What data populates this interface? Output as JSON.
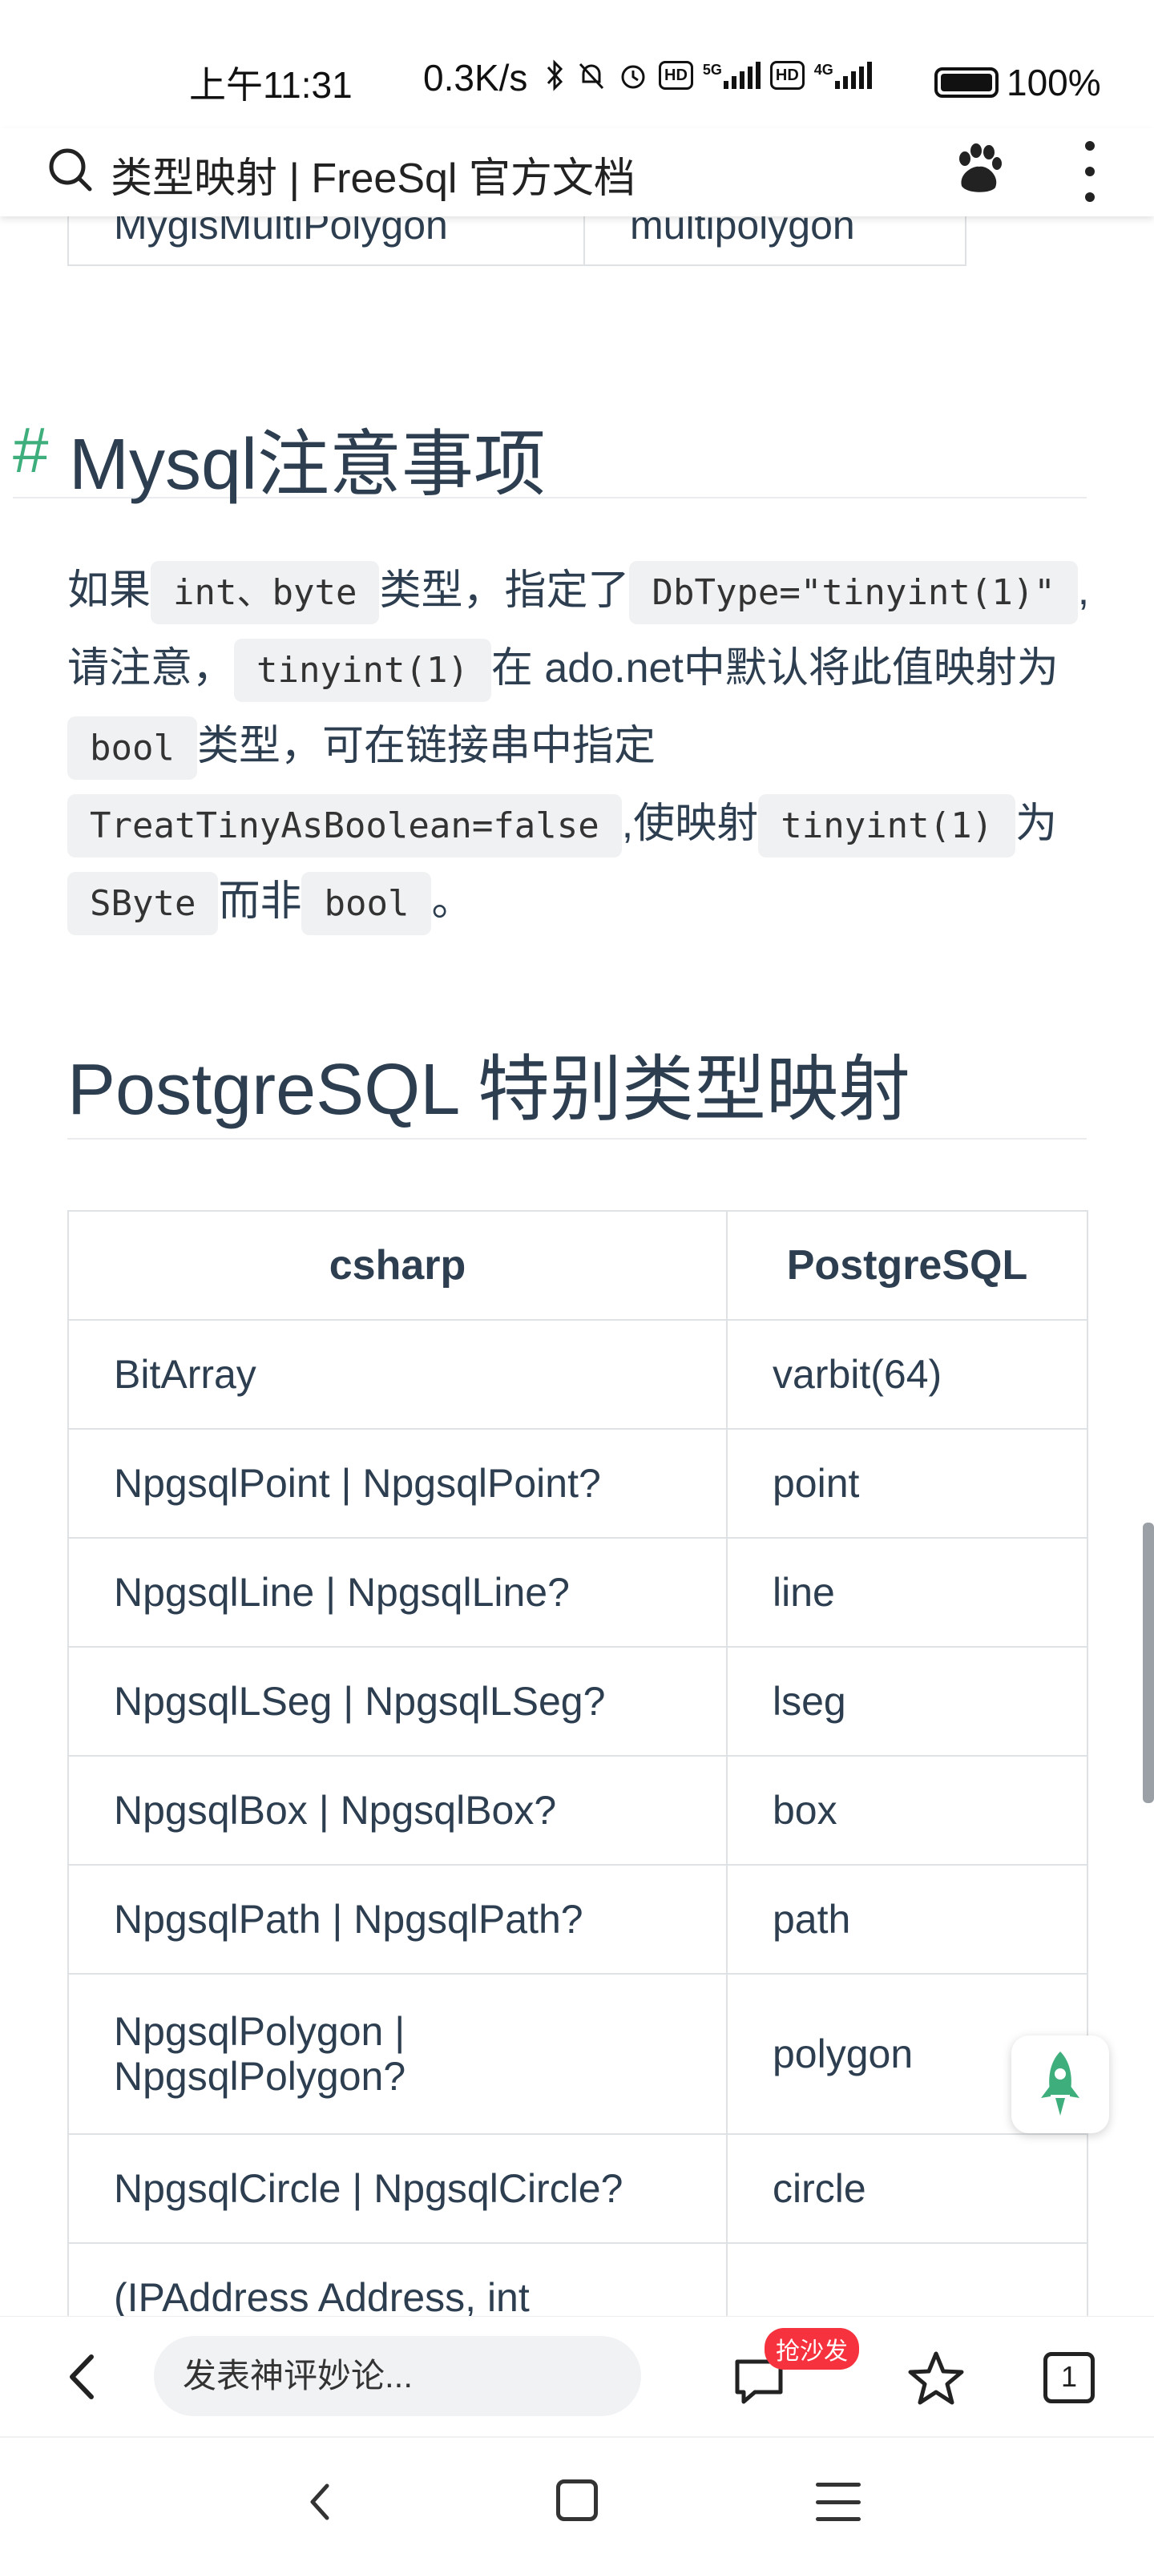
{
  "status": {
    "time": "上午11:31",
    "speed": "0.3K/s",
    "net1": "5G",
    "net2": "4G",
    "hd": "HD",
    "battery": "100%"
  },
  "address": {
    "title": "类型映射 | FreeSql 官方文档"
  },
  "top_table": {
    "row": [
      "MygisMultiPolygon",
      "multipolygon"
    ]
  },
  "mysql_section": {
    "anchor": "#",
    "heading": "Mysql注意事项",
    "p": {
      "t1": "如果",
      "c1": "int、byte",
      "t2": "类型，指定了",
      "c2": "DbType=\"tinyint(1)\"",
      "t3": ",请注意，",
      "c3": "tinyint(1)",
      "t4": "在 ado.net中默认将此值映射为",
      "c4": "bool",
      "t5": "类型，可在链接串中指定",
      "c5": "TreatTinyAsBoolean=false",
      "t6": ",使映射",
      "c6": "tinyint(1)",
      "t7": "为",
      "c7": "SByte",
      "t8": "而非",
      "c8": "bool",
      "t9": "。"
    }
  },
  "pg_section": {
    "heading": "PostgreSQL 特别类型映射",
    "headers": [
      "csharp",
      "PostgreSQL"
    ],
    "rows": [
      [
        "BitArray",
        "varbit(64)"
      ],
      [
        "NpgsqlPoint | NpgsqlPoint?",
        "point"
      ],
      [
        "NpgsqlLine | NpgsqlLine?",
        "line"
      ],
      [
        "NpgsqlLSeg | NpgsqlLSeg?",
        "lseg"
      ],
      [
        "NpgsqlBox | NpgsqlBox?",
        "box"
      ],
      [
        "NpgsqlPath | NpgsqlPath?",
        "path"
      ],
      [
        "NpgsqlPolygon | NpgsqlPolygon?",
        "polygon"
      ],
      [
        "NpgsqlCircle | NpgsqlCircle?",
        "circle"
      ],
      [
        "(IPAddress Address, int",
        ""
      ]
    ]
  },
  "bottom": {
    "comment_placeholder": "发表神评妙论...",
    "badge": "抢沙发",
    "tabs_count": "1"
  },
  "colors": {
    "accent": "#3eaf7c",
    "text": "#2c3e50",
    "badge": "#f5323d",
    "code_bg": "#f0f1f2"
  }
}
